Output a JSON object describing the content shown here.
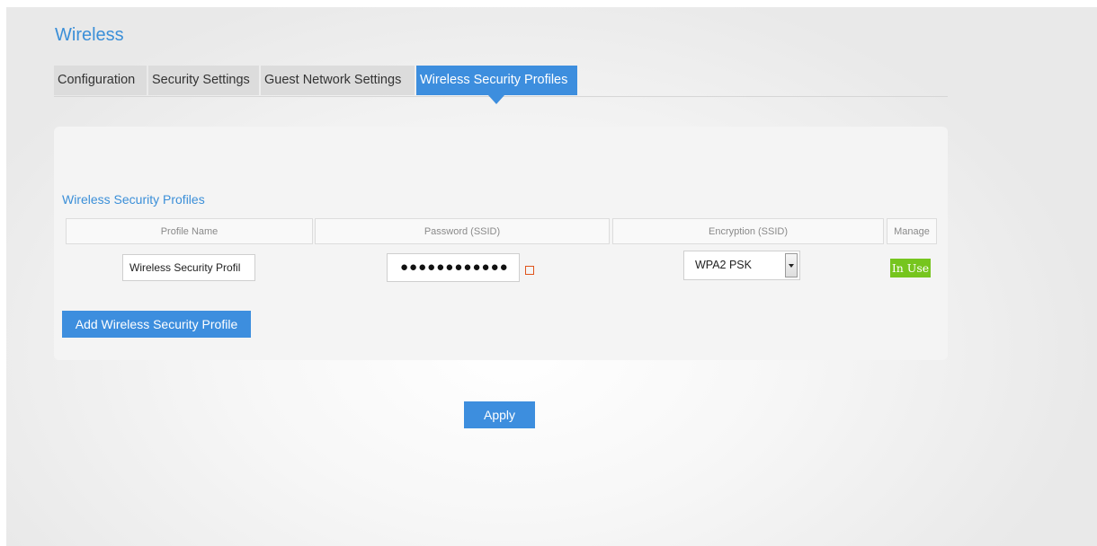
{
  "page": {
    "title": "Wireless"
  },
  "tabs": [
    {
      "label": "Configuration",
      "active": false
    },
    {
      "label": "Security Settings",
      "active": false
    },
    {
      "label": "Guest Network Settings",
      "active": false
    },
    {
      "label": "Wireless Security Profiles",
      "active": true
    }
  ],
  "section": {
    "title": "Wireless Security Profiles"
  },
  "table": {
    "headers": [
      "Profile Name",
      "Password (SSID)",
      "Encryption (SSID)",
      "Manage"
    ],
    "rows": [
      {
        "profile_name": "Wireless Security Profil",
        "password_masked": "●●●●●●●●●●●●",
        "encryption": "WPA2 PSK",
        "manage_status": "In Use"
      }
    ]
  },
  "buttons": {
    "add_profile": "Add Wireless Security Profile",
    "apply": "Apply"
  },
  "icons": {
    "password_toggle": "show-password-icon",
    "select_arrow": "dropdown-arrow-icon"
  },
  "colors": {
    "accent": "#3d8ede",
    "title_text": "#3b8fd8",
    "in_use_badge": "#76c51e",
    "password_toggle_icon": "#e0541c"
  }
}
